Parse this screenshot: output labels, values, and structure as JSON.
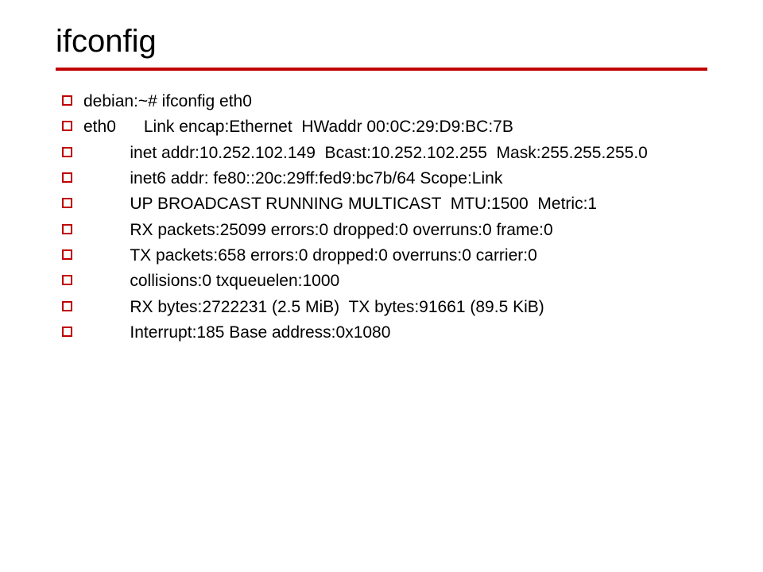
{
  "title": "ifconfig",
  "lines": [
    "debian:~# ifconfig eth0",
    "eth0      Link encap:Ethernet  HWaddr 00:0C:29:D9:BC:7B",
    "          inet addr:10.252.102.149  Bcast:10.252.102.255  Mask:255.255.255.0",
    "          inet6 addr: fe80::20c:29ff:fed9:bc7b/64 Scope:Link",
    "          UP BROADCAST RUNNING MULTICAST  MTU:1500  Metric:1",
    "          RX packets:25099 errors:0 dropped:0 overruns:0 frame:0",
    "          TX packets:658 errors:0 dropped:0 overruns:0 carrier:0",
    "          collisions:0 txqueuelen:1000",
    "          RX bytes:2722231 (2.5 MiB)  TX bytes:91661 (89.5 KiB)",
    "          Interrupt:185 Base address:0x1080"
  ]
}
